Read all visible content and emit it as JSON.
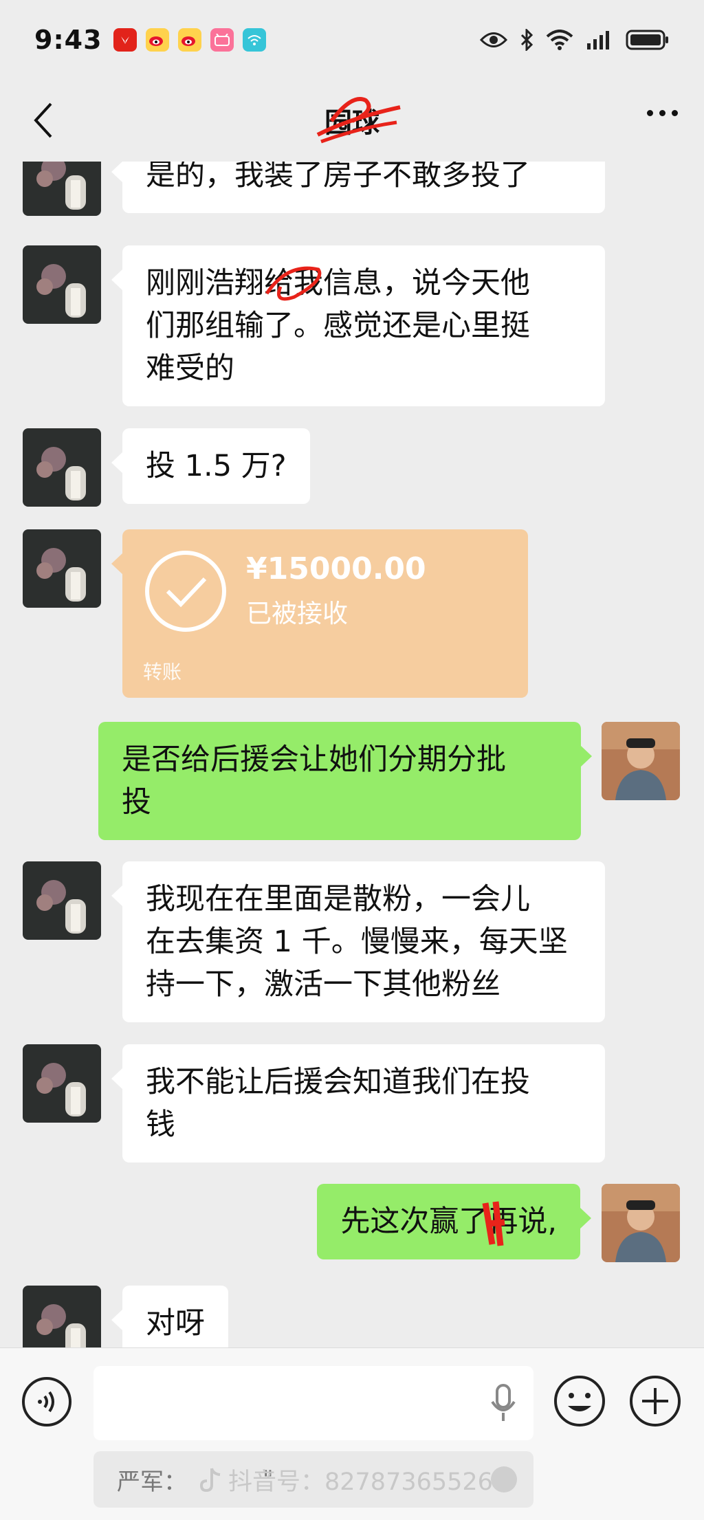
{
  "status_bar": {
    "time": "9:43",
    "app_icons": [
      "huawei-app-icon",
      "weibo-icon",
      "weibo-icon",
      "bilibili-icon",
      "wifi-app-icon"
    ],
    "right_icons": [
      "eye-icon",
      "bluetooth-icon",
      "wifi-icon",
      "signal-icon",
      "battery-icon"
    ]
  },
  "nav": {
    "title": "园球",
    "back_icon": "back-chevron-icon",
    "more_icon": "more-dots-icon"
  },
  "messages": [
    {
      "side": "left",
      "type": "text",
      "lines": [
        "是的，我装了房子不敢多投了"
      ]
    },
    {
      "side": "left",
      "type": "text",
      "lines": [
        "刚刚浩翔给我信息，说今天他",
        "们那组输了。感觉还是心里挺",
        "难受的"
      ]
    },
    {
      "side": "left",
      "type": "text",
      "lines": [
        "投 1.5 万?"
      ]
    },
    {
      "side": "left",
      "type": "transfer",
      "amount": "¥15000.00",
      "status": "已被接收",
      "label": "转账"
    },
    {
      "side": "right",
      "type": "text",
      "lines": [
        "是否给后援会让她们分期分批",
        "投"
      ]
    },
    {
      "side": "left",
      "type": "text",
      "lines": [
        "我现在在里面是散粉，一会儿",
        "在去集资 1 千。慢慢来，每天坚",
        "持一下，激活一下其他粉丝"
      ]
    },
    {
      "side": "left",
      "type": "text",
      "lines": [
        "我不能让后援会知道我们在投",
        "钱"
      ]
    },
    {
      "side": "right",
      "type": "text",
      "lines": [
        "先这次赢了再说,"
      ]
    },
    {
      "side": "left",
      "type": "text",
      "lines": [
        "对呀"
      ]
    }
  ],
  "input_bar": {
    "voice_icon": "voice-icon",
    "mic_icon": "mic-icon",
    "emoji_icon": "emoji-icon",
    "plus_icon": "plus-icon",
    "quote_text": "严军：",
    "quote_suffix": "\"",
    "watermark": "抖音号：82787365526"
  },
  "colors": {
    "background": "#ededed",
    "bubble_left": "#ffffff",
    "bubble_right": "#95ec69",
    "transfer": "#f6cd9f",
    "redaction": "#e8231a"
  }
}
